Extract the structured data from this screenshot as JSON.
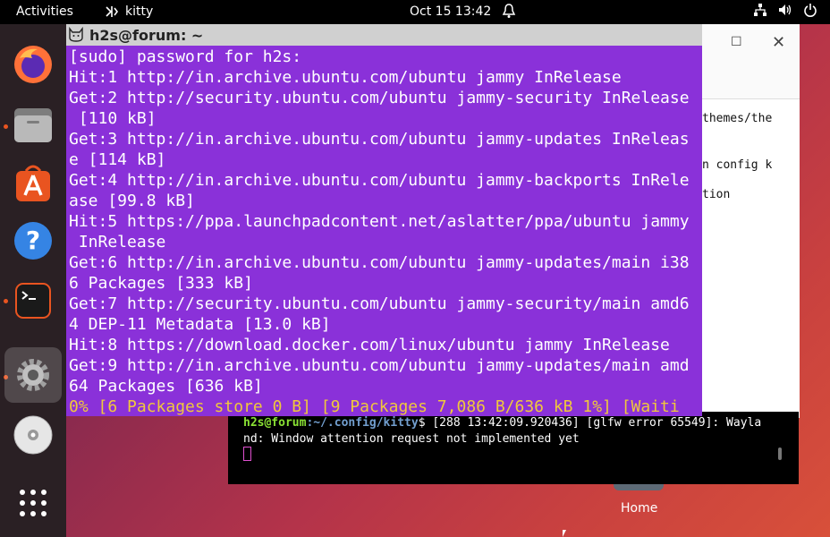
{
  "topbar": {
    "activities": "Activities",
    "app_name": "kitty",
    "clock": "Oct 15  13:42"
  },
  "dock": {
    "items": [
      {
        "name": "Firefox"
      },
      {
        "name": "Files"
      },
      {
        "name": "Ubuntu Software"
      },
      {
        "name": "Help"
      },
      {
        "name": "Terminal"
      },
      {
        "name": "Settings"
      },
      {
        "name": "Disc"
      },
      {
        "name": "Show Applications"
      }
    ]
  },
  "kitty": {
    "title": "h2s@forum: ~",
    "lines": [
      "[sudo] password for h2s:",
      "Hit:1 http://in.archive.ubuntu.com/ubuntu jammy InRelease",
      "Get:2 http://security.ubuntu.com/ubuntu jammy-security InRelease",
      " [110 kB]",
      "Get:3 http://in.archive.ubuntu.com/ubuntu jammy-updates InReleas",
      "e [114 kB]",
      "Get:4 http://in.archive.ubuntu.com/ubuntu jammy-backports InRele",
      "ase [99.8 kB]",
      "Hit:5 https://ppa.launchpadcontent.net/aslatter/ppa/ubuntu jammy",
      " InRelease",
      "Get:6 http://in.archive.ubuntu.com/ubuntu jammy-updates/main i38",
      "6 Packages [333 kB]",
      "Get:7 http://security.ubuntu.com/ubuntu jammy-security/main amd6",
      "4 DEP-11 Metadata [13.0 kB]",
      "Hit:8 https://download.docker.com/linux/ubuntu jammy InRelease",
      "Get:9 http://in.archive.ubuntu.com/ubuntu jammy-updates/main amd",
      "64 Packages [636 kB]"
    ],
    "progress_line": "0% [6 Packages store 0 B] [9 Packages 7,086 B/636 kB 1%] [Waiti"
  },
  "background_window": {
    "line1": "themes/the",
    "line2": "n config k",
    "line3": "tion"
  },
  "dark_terminal": {
    "prompt_user": "h2s@forum",
    "prompt_path": ":~/.config/kitty",
    "prompt_tail": "$ [288 13:42:09.920436] [glfw error 65549]: Wayla",
    "line2": "nd: Window attention request not implemented yet"
  },
  "desktop": {
    "home_label": "Home"
  }
}
